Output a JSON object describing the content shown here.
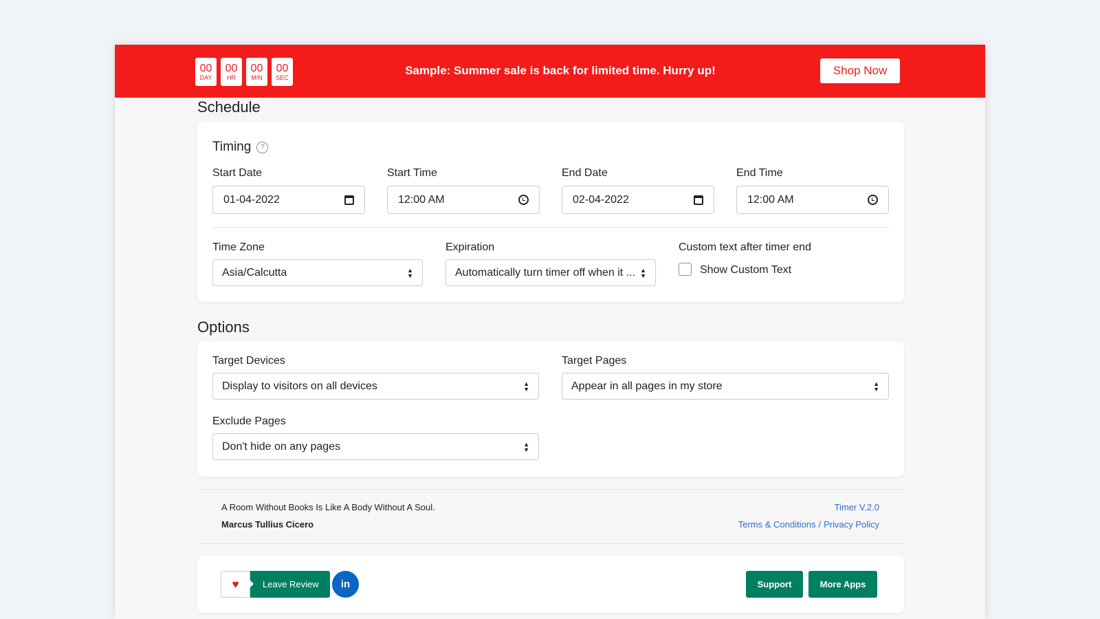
{
  "banner": {
    "timer": [
      {
        "value": "00",
        "unit": "DAY"
      },
      {
        "value": "00",
        "unit": "HR"
      },
      {
        "value": "00",
        "unit": "MIN"
      },
      {
        "value": "00",
        "unit": "SEC"
      }
    ],
    "message": "Sample: Summer sale is back for limited time. Hurry up!",
    "shop_label": "Shop Now",
    "color": "#f41b1b"
  },
  "schedule": {
    "title": "Schedule",
    "timing_heading": "Timing",
    "help_glyph": "?",
    "start_date": {
      "label": "Start Date",
      "value": "01-04-2022"
    },
    "start_time": {
      "label": "Start Time",
      "value": "12:00 AM"
    },
    "end_date": {
      "label": "End Date",
      "value": "02-04-2022"
    },
    "end_time": {
      "label": "End Time",
      "value": "12:00 AM"
    },
    "time_zone": {
      "label": "Time Zone",
      "value": "Asia/Calcutta"
    },
    "expiration": {
      "label": "Expiration",
      "value": "Automatically turn timer off when it ..."
    },
    "custom_text": {
      "label": "Custom text after timer end",
      "checkbox_label": "Show Custom Text",
      "checked": false
    }
  },
  "options": {
    "title": "Options",
    "target_devices": {
      "label": "Target Devices",
      "value": "Display to visitors on all devices"
    },
    "target_pages": {
      "label": "Target Pages",
      "value": "Appear in all pages in my store"
    },
    "exclude_pages": {
      "label": "Exclude Pages",
      "value": "Don't hide on any pages"
    }
  },
  "footer": {
    "quote": "A Room Without Books Is Like A Body Without A Soul.",
    "author": "Marcus Tullius Cicero",
    "version": "Timer V.2.0",
    "terms": "Terms & Conditions",
    "separator": "/",
    "privacy": "Privacy Policy"
  },
  "actions": {
    "review_label": "Leave Review",
    "linkedin_label": "in",
    "support_label": "Support",
    "more_apps_label": "More Apps",
    "accent": "#008060"
  }
}
